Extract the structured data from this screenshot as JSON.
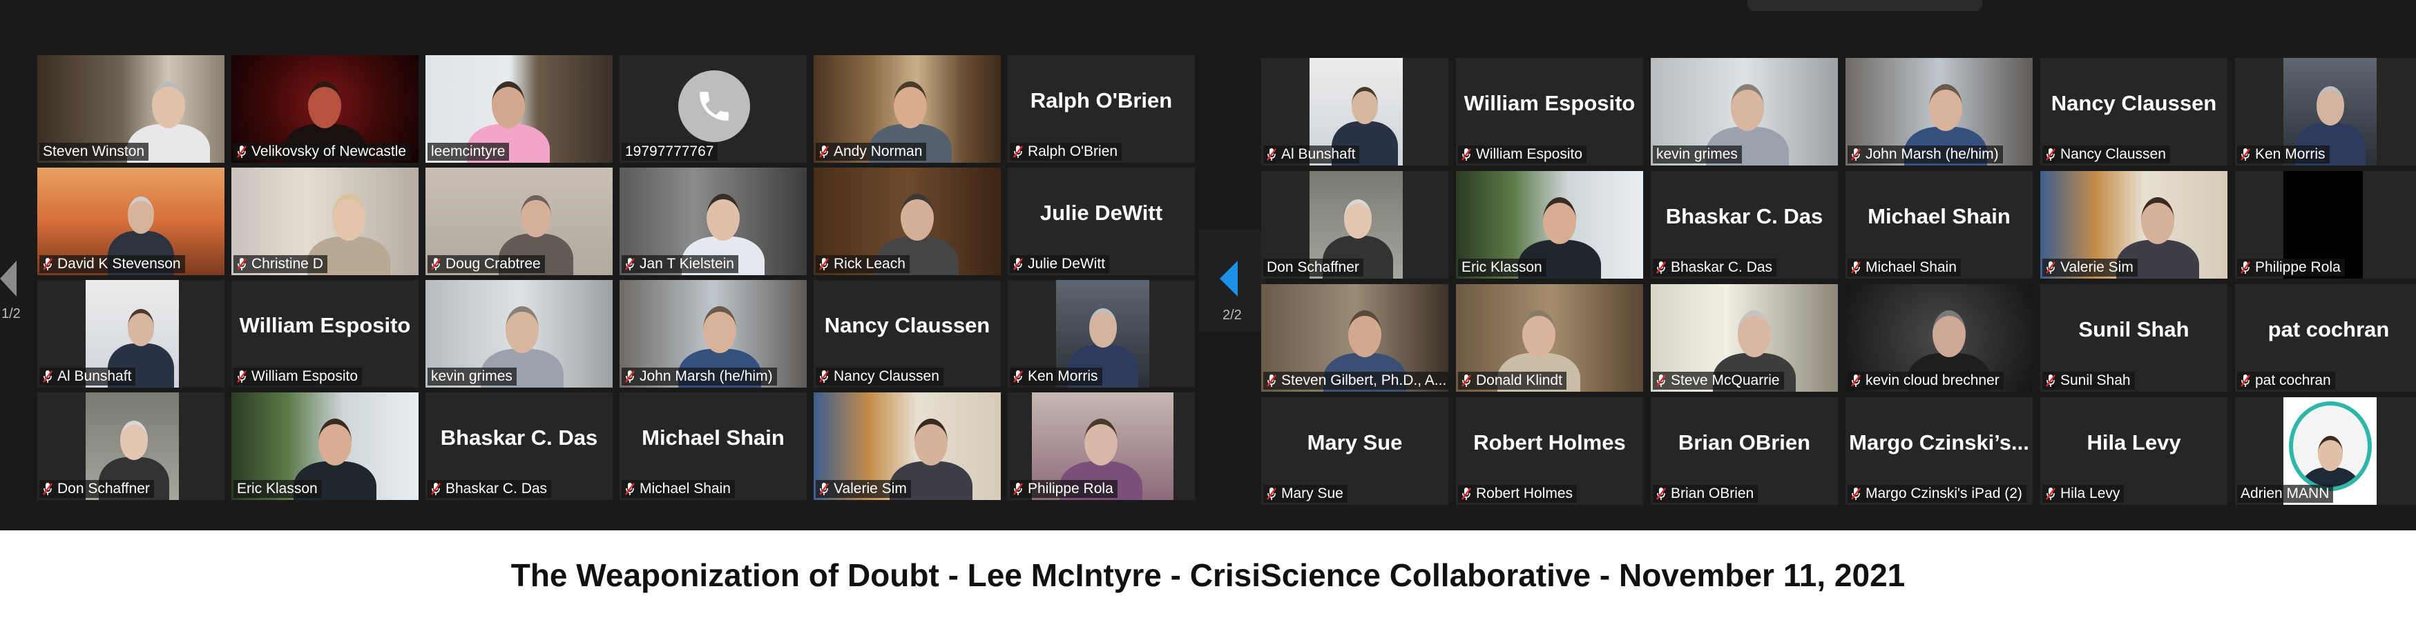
{
  "app": {
    "name": "Zoom gallery view"
  },
  "pages": {
    "left_indicator": "1/2",
    "right_indicator": "2/2"
  },
  "caption": "The Weaponization of Doubt - Lee McIntyre - CrisiScience Collaborative - November 11, 2021",
  "colors": {
    "background": "#1a1a1a",
    "tile": "#262626",
    "active_speaker": "#c9e07a",
    "nav_arrow": "#1e90e6",
    "muted_icon": "#e02828"
  },
  "left_gallery": {
    "rows": [
      [
        {
          "name": "Steven Winston",
          "muted": false,
          "video": "room-window"
        },
        {
          "name": "Velikovsky of Newcastle",
          "muted": true,
          "video": "red-dark"
        },
        {
          "name": "leemcintyre",
          "muted": false,
          "video": "bookshelf",
          "active": true
        },
        {
          "name": "19797777767",
          "muted": false,
          "video": "phone"
        },
        {
          "name": "Andy Norman",
          "muted": true,
          "video": "bookshelf-warm"
        },
        {
          "name": "Ralph O'Brien",
          "muted": true,
          "video": "none",
          "big": "Ralph O'Brien"
        }
      ],
      [
        {
          "name": "David K Stevenson",
          "muted": true,
          "video": "sunset"
        },
        {
          "name": "Christine D",
          "muted": true,
          "video": "kitchen"
        },
        {
          "name": "Doug Crabtree",
          "muted": true,
          "video": "beige"
        },
        {
          "name": "Jan T Kielstein",
          "muted": true,
          "video": "office-dark"
        },
        {
          "name": "Rick Leach",
          "muted": true,
          "video": "wood"
        },
        {
          "name": "Julie DeWitt",
          "muted": true,
          "video": "none",
          "big": "Julie DeWitt"
        }
      ],
      [
        {
          "name": "Al Bunshaft",
          "muted": true,
          "video": "robot"
        },
        {
          "name": "William Esposito",
          "muted": true,
          "video": "none",
          "big": "William Esposito"
        },
        {
          "name": "kevin grimes",
          "muted": false,
          "video": "whiteboard"
        },
        {
          "name": "John Marsh (he/him)",
          "muted": true,
          "video": "office-blue"
        },
        {
          "name": "Nancy Claussen",
          "muted": true,
          "video": "none",
          "big": "Nancy Claussen"
        },
        {
          "name": "Ken Morris",
          "muted": true,
          "video": "grey-man"
        }
      ],
      [
        {
          "name": "Don Schaffner",
          "muted": true,
          "video": "white-beard"
        },
        {
          "name": "Eric Klasson",
          "muted": false,
          "video": "plants"
        },
        {
          "name": "Bhaskar C. Das",
          "muted": true,
          "video": "none",
          "big": "Bhaskar C. Das"
        },
        {
          "name": "Michael Shain",
          "muted": true,
          "video": "none",
          "big": "Michael Shain"
        },
        {
          "name": "Valerie Sim",
          "muted": true,
          "video": "painting"
        },
        {
          "name": "Philippe Rola",
          "muted": true,
          "video": "mask"
        }
      ]
    ]
  },
  "right_gallery": {
    "rows": [
      [
        {
          "name": "Al Bunshaft",
          "muted": true,
          "video": "robot"
        },
        {
          "name": "William Esposito",
          "muted": true,
          "video": "none",
          "big": "William Esposito"
        },
        {
          "name": "kevin grimes",
          "muted": false,
          "video": "whiteboard"
        },
        {
          "name": "John Marsh (he/him)",
          "muted": true,
          "video": "office-blue"
        },
        {
          "name": "Nancy Claussen",
          "muted": true,
          "video": "none",
          "big": "Nancy Claussen"
        },
        {
          "name": "Ken Morris",
          "muted": true,
          "video": "grey-man"
        }
      ],
      [
        {
          "name": "Don Schaffner",
          "muted": false,
          "video": "white-beard"
        },
        {
          "name": "Eric Klasson",
          "muted": false,
          "video": "plants"
        },
        {
          "name": "Bhaskar C. Das",
          "muted": true,
          "video": "none",
          "big": "Bhaskar C. Das"
        },
        {
          "name": "Michael Shain",
          "muted": true,
          "video": "none",
          "big": "Michael Shain"
        },
        {
          "name": "Valerie Sim",
          "muted": true,
          "video": "painting"
        },
        {
          "name": "Philippe Rola",
          "muted": true,
          "video": "black"
        }
      ],
      [
        {
          "name": "Steven Gilbert, Ph.D., A...",
          "muted": true,
          "video": "desk-man"
        },
        {
          "name": "Donald Klindt",
          "muted": true,
          "video": "couch"
        },
        {
          "name": "Steve McQuarrie",
          "muted": true,
          "video": "window-bright"
        },
        {
          "name": "kevin cloud brechner",
          "muted": true,
          "video": "blur-dark"
        },
        {
          "name": "Sunil Shah",
          "muted": true,
          "video": "none",
          "big": "Sunil Shah"
        },
        {
          "name": "pat cochran",
          "muted": true,
          "video": "none",
          "big": "pat cochran"
        }
      ],
      [
        {
          "name": "Mary Sue",
          "muted": true,
          "video": "none",
          "big": "Mary Sue"
        },
        {
          "name": "Robert Holmes",
          "muted": true,
          "video": "none",
          "big": "Robert Holmes"
        },
        {
          "name": "Brian OBrien",
          "muted": true,
          "video": "none",
          "big": "Brian OBrien"
        },
        {
          "name": "Margo Czinski's iPad (2)",
          "muted": true,
          "video": "none",
          "big": "Margo  Czinski’s..."
        },
        {
          "name": "Hila Levy",
          "muted": true,
          "video": "none",
          "big": "Hila Levy"
        },
        {
          "name": "Adrien MANN",
          "muted": false,
          "video": "avatar-circle"
        }
      ]
    ]
  }
}
